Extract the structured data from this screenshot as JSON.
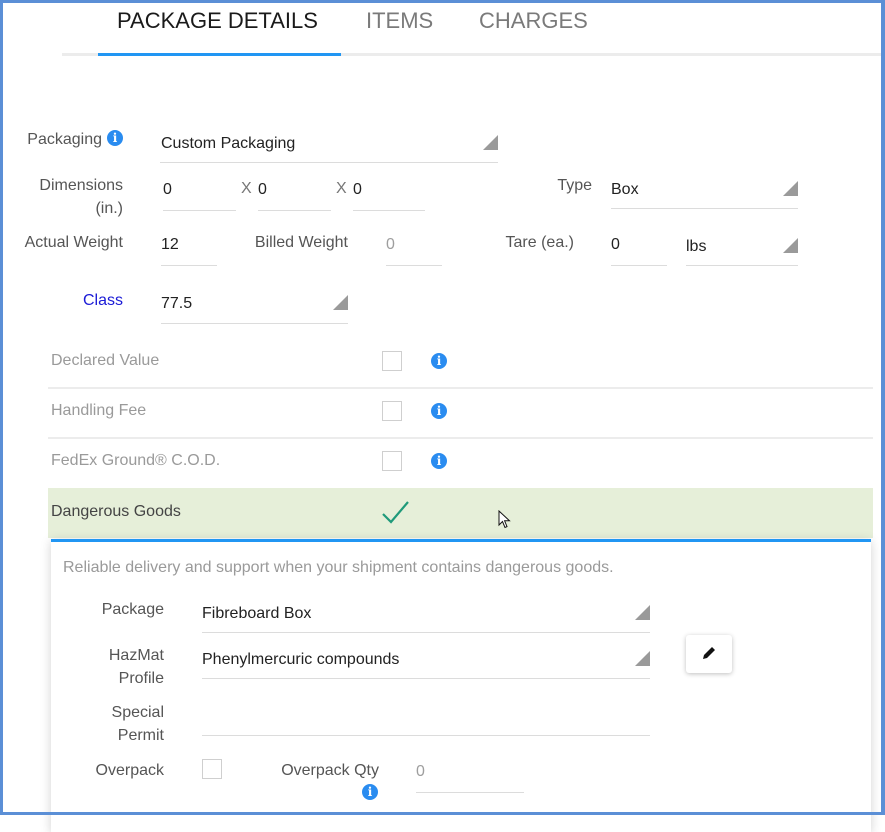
{
  "tabs": [
    {
      "label": "PACKAGE DETAILS",
      "active": true
    },
    {
      "label": "ITEMS",
      "active": false
    },
    {
      "label": "CHARGES",
      "active": false
    }
  ],
  "form": {
    "packaging": {
      "label": "Packaging",
      "value": "Custom Packaging",
      "icon": "info-icon"
    },
    "dimensions": {
      "label_line1": "Dimensions",
      "label_line2": "(in.)",
      "length": "0",
      "width": "0",
      "height": "0",
      "separator": "X"
    },
    "type": {
      "label": "Type",
      "value": "Box"
    },
    "actual_weight": {
      "label": "Actual Weight",
      "value": "12"
    },
    "billed_weight": {
      "label": "Billed Weight",
      "value": "0"
    },
    "tare": {
      "label": "Tare (ea.)",
      "value": "0",
      "unit": "lbs"
    },
    "class": {
      "label": "Class",
      "value": "77.5"
    }
  },
  "options": [
    {
      "label": "Declared Value",
      "checked": false
    },
    {
      "label": "Handling Fee",
      "checked": false
    },
    {
      "label": "FedEx Ground® C.O.D.",
      "checked": false
    }
  ],
  "dangerous_goods": {
    "label": "Dangerous Goods",
    "checked": true,
    "description": "Reliable delivery and support when your shipment contains dangerous goods.",
    "package": {
      "label": "Package",
      "value": "Fibreboard Box"
    },
    "hazmat_profile": {
      "label_line1": "HazMat",
      "label_line2": "Profile",
      "value": "Phenylmercuric compounds"
    },
    "special_permit": {
      "label_line1": "Special",
      "label_line2": "Permit",
      "value": ""
    },
    "overpack": {
      "label": "Overpack",
      "checked": false
    },
    "overpack_qty": {
      "label": "Overpack Qty",
      "value": "0"
    }
  },
  "colors": {
    "accent": "#2196f3",
    "frame": "#5b8fd6",
    "checked_row_bg": "#e6efd9",
    "checkmark": "#1f9a7a",
    "class_label": "#1a1ad6"
  }
}
